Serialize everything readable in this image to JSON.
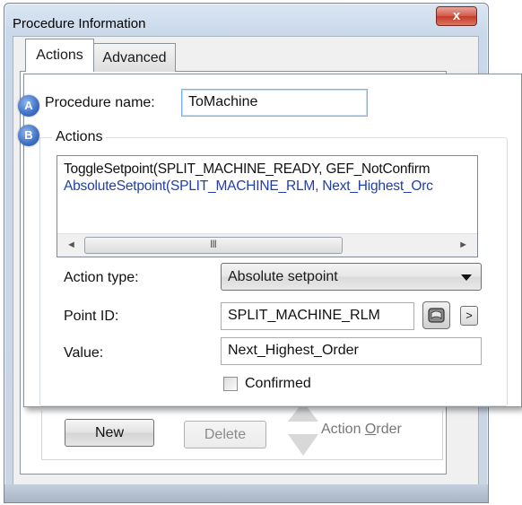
{
  "window": {
    "title": "Procedure Information",
    "close_glyph": "x"
  },
  "tabs": [
    {
      "label": "Actions",
      "active": true
    },
    {
      "label": "Advanced",
      "active": false
    }
  ],
  "callouts": {
    "a": "A",
    "b": "B"
  },
  "procedure": {
    "name_label": "Procedure name:",
    "name_value": "ToMachine"
  },
  "actions": {
    "group_label": "Actions",
    "items": [
      {
        "text": "ToggleSetpoint(SPLIT_MACHINE_READY, GEF_NotConfirm",
        "color": "#111111",
        "selected": false
      },
      {
        "text": "AbsoluteSetpoint(SPLIT_MACHINE_RLM, Next_Highest_Orc",
        "color": "#1f3fa8",
        "selected": true
      }
    ],
    "scroll_left_glyph": "◄",
    "scroll_right_glyph": "►",
    "scroll_grip_glyph": "III"
  },
  "fields": {
    "action_type_label": "Action type:",
    "action_type_value": "Absolute setpoint",
    "point_id_label": "Point ID:",
    "point_id_value": "SPLIT_MACHINE_RLM",
    "point_picker_icon": "point-browser-icon",
    "more_glyph": ">",
    "value_label": "Value:",
    "value_value": "Next_Highest_Order",
    "confirmed_label": "Confirmed",
    "confirmed_checked": false
  },
  "buttons": {
    "new_label": "New",
    "delete_label": "Delete",
    "action_order_prefix": "Action ",
    "action_order_underlined": "O",
    "action_order_suffix": "rder"
  },
  "colors": {
    "callout_badge": "#3d6fc4",
    "selected_item_text": "#1f3fa8",
    "close_button": "#c43a2a"
  }
}
